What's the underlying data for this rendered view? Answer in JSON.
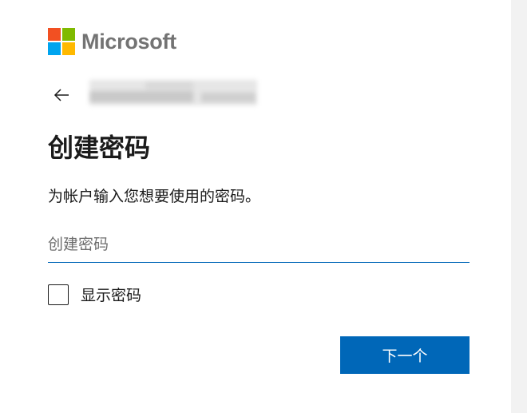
{
  "brand": {
    "name": "Microsoft"
  },
  "back": {
    "icon": "arrow-left-icon"
  },
  "heading": "创建密码",
  "description": "为帐户输入您想要使用的密码。",
  "password_field": {
    "placeholder": "创建密码",
    "value": ""
  },
  "show_password": {
    "label": "显示密码",
    "checked": false
  },
  "next_button": {
    "label": "下一个"
  },
  "colors": {
    "accent": "#0067b8",
    "logo_red": "#f25022",
    "logo_green": "#7fba00",
    "logo_blue": "#00a4ef",
    "logo_yellow": "#ffb900"
  }
}
